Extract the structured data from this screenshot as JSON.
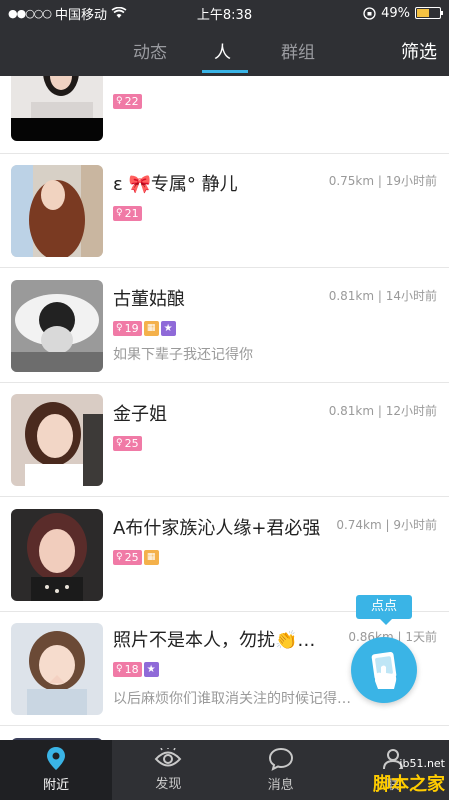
{
  "status": {
    "carrier": "中国移动",
    "time": "上午8:38",
    "battery": "49%",
    "battery_level": 0.49
  },
  "nav": {
    "tabs": [
      "动态",
      "人",
      "群组"
    ],
    "active_tab": 1,
    "filter_label": "筛选"
  },
  "users": [
    {
      "name": "",
      "age": "22",
      "distance": "",
      "signature": ""
    },
    {
      "name": "ε 🎀专属° 静儿",
      "age": "21",
      "distance": "0.75km | 19小时前",
      "signature": ""
    },
    {
      "name": "古董姑酿",
      "age": "19",
      "distance": "0.81km | 14小时前",
      "signature": "如果下辈子我还记得你"
    },
    {
      "name": "金子姐",
      "age": "25",
      "distance": "0.81km | 12小时前",
      "signature": ""
    },
    {
      "name": "A布什家族沁人缘+君必强",
      "age": "25",
      "distance": "0.74km | 9小时前",
      "signature": ""
    },
    {
      "name": "照片不是本人，勿扰👏…",
      "age": "18",
      "distance": "0.86km | 1天前",
      "signature": "以后麻烦你们谁取消关注的时候记得…"
    }
  ],
  "fab": {
    "label": "点点"
  },
  "tabbar": [
    {
      "label": "附近",
      "icon": "location-pin-icon"
    },
    {
      "label": "发现",
      "icon": "eye-icon"
    },
    {
      "label": "消息",
      "icon": "chat-bubble-icon"
    },
    {
      "label": "联",
      "icon": "contacts-icon"
    }
  ],
  "watermark": {
    "url": "jb51.net",
    "text": "脚本之家"
  },
  "colors": {
    "accent": "#3ab4e6",
    "bar": "#2f3034",
    "age_badge": "#f07aa6"
  }
}
